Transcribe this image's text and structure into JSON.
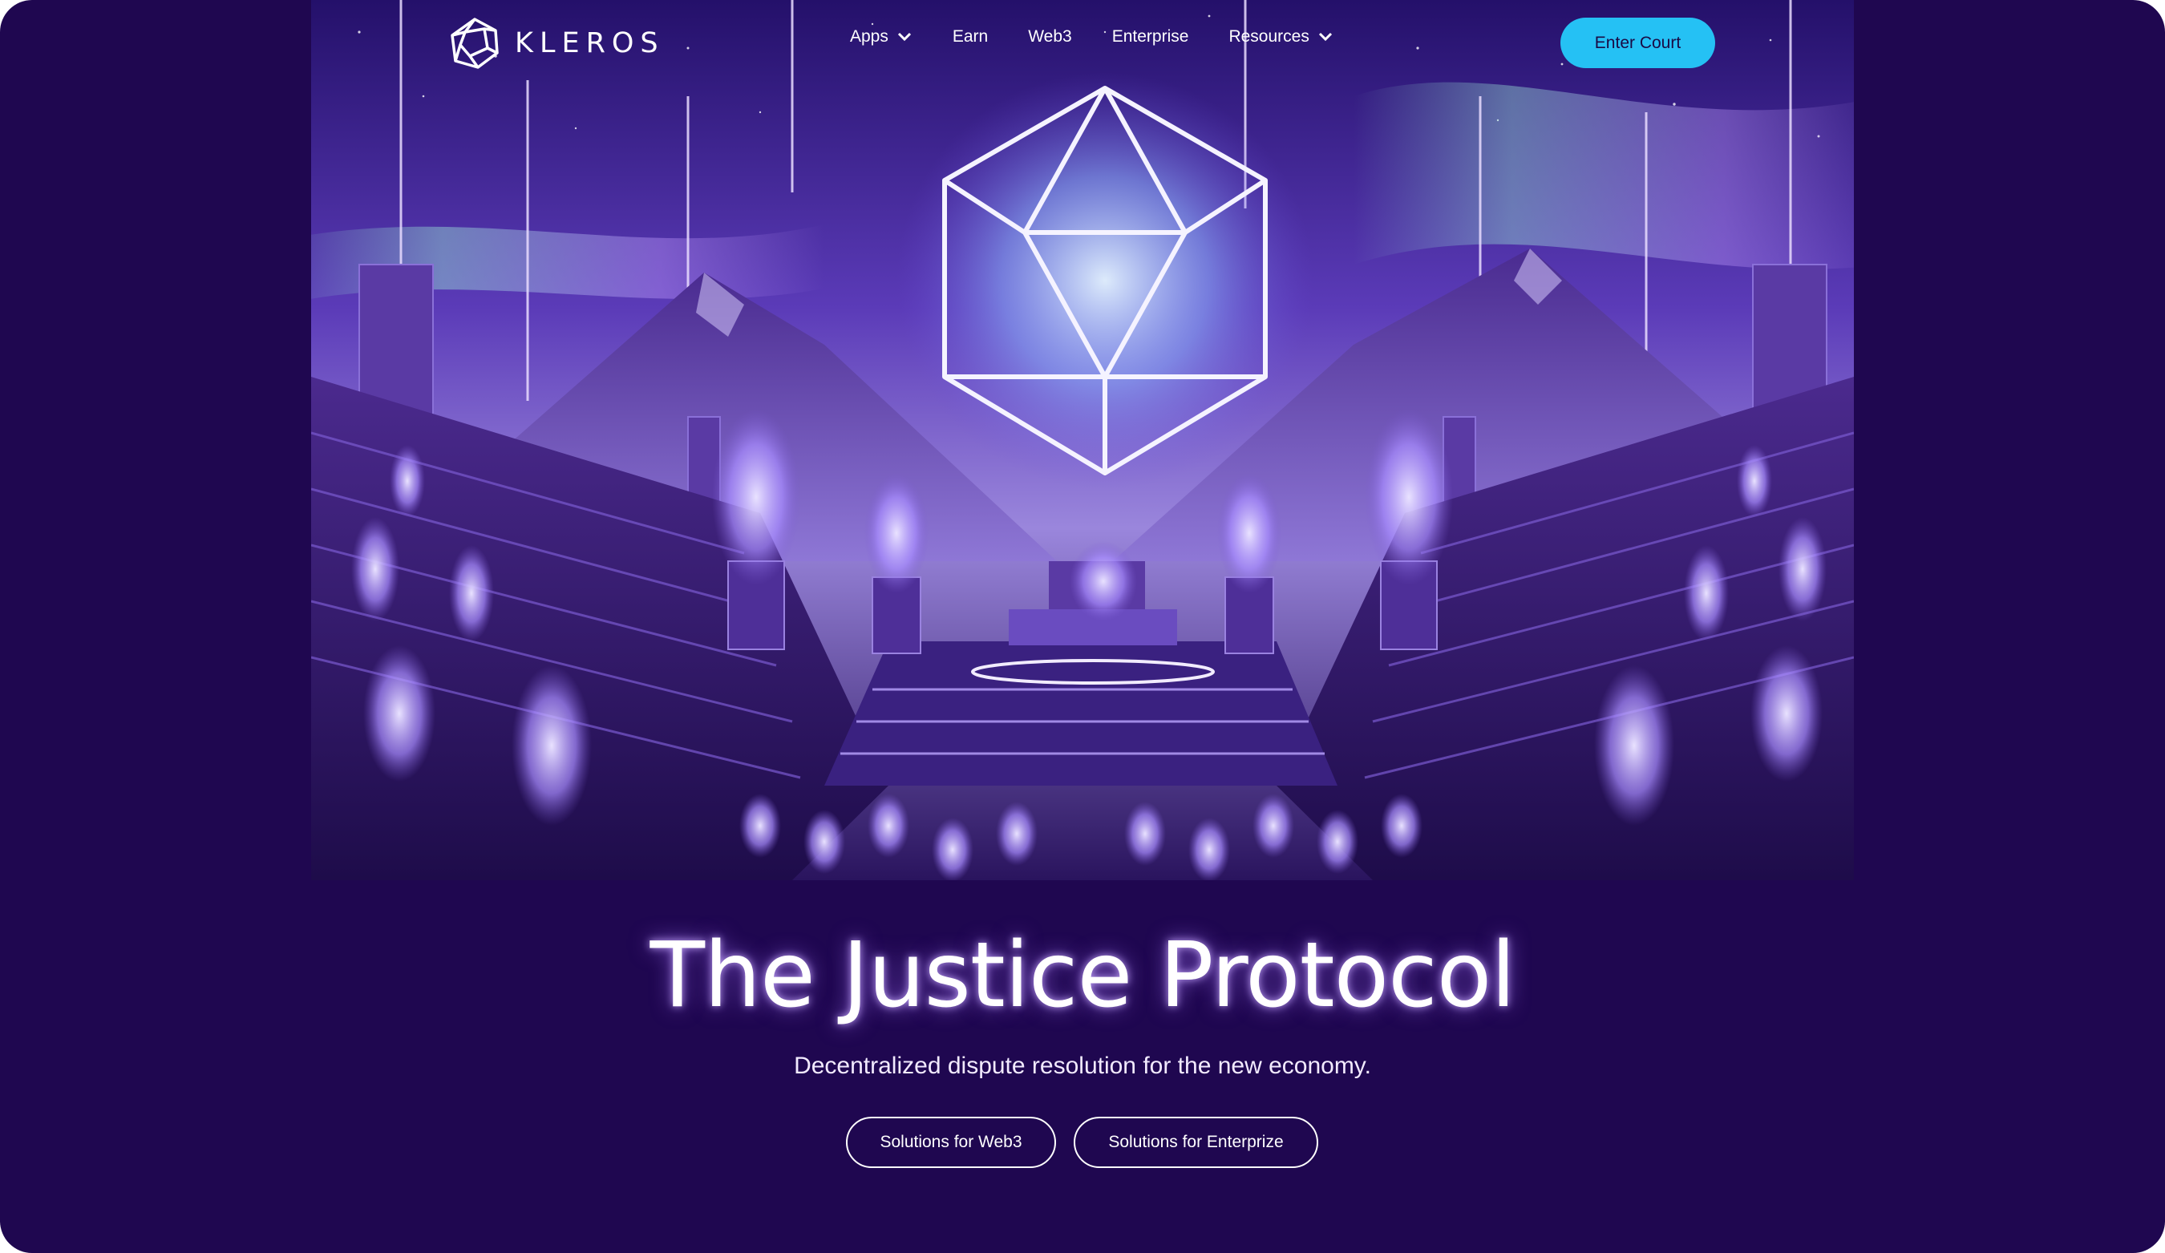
{
  "brand": {
    "name": "KLEROS",
    "logo_icon": "kleros-logo-icon"
  },
  "nav": {
    "items": [
      {
        "label": "Apps",
        "has_dropdown": true
      },
      {
        "label": "Earn",
        "has_dropdown": false
      },
      {
        "label": "Web3",
        "has_dropdown": false
      },
      {
        "label": "Enterprise",
        "has_dropdown": false
      },
      {
        "label": "Resources",
        "has_dropdown": true
      }
    ],
    "cta_label": "Enter Court"
  },
  "hero": {
    "title": "The Justice Protocol",
    "subtitle": "Decentralized dispute resolution for the new economy.",
    "buttons": [
      {
        "label": "Solutions for Web3"
      },
      {
        "label": "Solutions for Enterprize"
      }
    ]
  },
  "colors": {
    "background": "#1f0750",
    "accent": "#25c1f4",
    "text": "#ffffff"
  }
}
